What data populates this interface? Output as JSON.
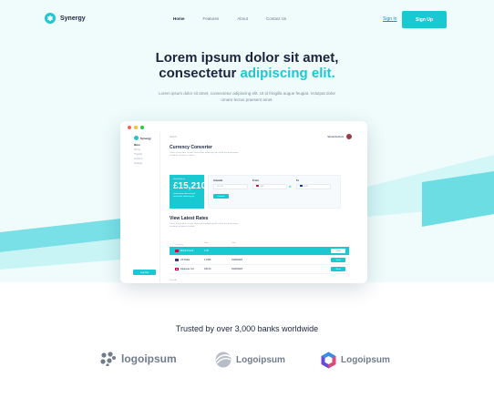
{
  "brand": {
    "name": "Synergy",
    "mark_color": "#1ec8d0"
  },
  "nav": {
    "links": [
      "Home",
      "Features",
      "About",
      "Contact Us"
    ],
    "signin_label": "Sign In",
    "signup_label": "Sign Up"
  },
  "hero": {
    "headline_line1": "Lorem ipsum dolor sit amet,",
    "headline_line2_plain": "consectetur",
    "headline_line2_accent": "adipiscing elit.",
    "subheadline": "Lorem ipsum dolor sit amet, consectetur adipiscing elit. Ut id fringilla augue feugiat. Volutpat dolor ornare lectus praesent amet."
  },
  "app": {
    "sidebar": {
      "brand": "Synergy",
      "menu_title": "Menu",
      "menu_items": [
        "Home",
        "Transfer",
        "Account",
        "Settings"
      ],
      "logout_label": "Log Out"
    },
    "search_placeholder": "Search",
    "user_name": "Samantha Ross",
    "converter": {
      "title": "Currency Converter",
      "description": "Lorem ipsum dolor sit amet consectetur adipiscing elit sed do eiusmod tempor incididunt ut labore et dolore.",
      "balance_label": "Total Balance",
      "balance_amount": "£15,210",
      "balance_note": "Lorem ipsum dolor sit amet consectetur adipiscing elit.",
      "amount_label": "Amount",
      "amount_value": "£15.00",
      "from_label": "From",
      "from_value": "GBP",
      "to_label": "To",
      "to_value": "EUR",
      "convert_label": "Convert"
    },
    "rates": {
      "title": "View Latest Rates",
      "description": "Lorem ipsum dolor sit amet consectetur adipiscing elit sed do eiusmod tempor incididunt ut labore et dolore.",
      "columns": [
        "Currency",
        "Rate",
        "Date"
      ],
      "rows": [
        {
          "currency": "British Pound",
          "rate": "1.00",
          "date": "",
          "action": "Send"
        },
        {
          "currency": "US Dollar",
          "rate": "1.2345",
          "date": "01/06/2023",
          "action": "Send"
        },
        {
          "currency": "Japanese Yen",
          "rate": "150.20",
          "date": "01/06/2023",
          "action": "Send"
        }
      ],
      "view_all": "View All"
    }
  },
  "trusted": {
    "heading": "Trusted by over 3,000 banks worldwide",
    "logos": [
      "logoipsum",
      "Logoipsum",
      "Logoipsum"
    ]
  },
  "colors": {
    "accent": "#18c9d1",
    "navy": "#1b2540",
    "hero_bg": "#effcfb"
  }
}
